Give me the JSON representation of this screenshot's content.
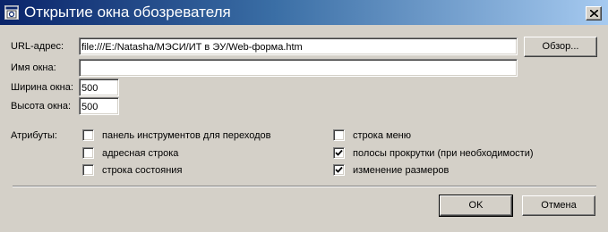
{
  "window": {
    "title": "Открытие окна обозревателя",
    "icon": "browser-window-icon",
    "close_icon": "close-icon"
  },
  "form": {
    "url": {
      "label": "URL-адрес:",
      "value": "file:///E:/Natasha/МЭСИ/ИТ в ЭУ/Web-форма.htm"
    },
    "browse_label": "Обзор...",
    "window_name": {
      "label": "Имя окна:",
      "value": ""
    },
    "width": {
      "label": "Ширина окна:",
      "value": "500"
    },
    "height": {
      "label": "Высота окна:",
      "value": "500"
    }
  },
  "attributes": {
    "label": "Атрибуты:",
    "items": [
      {
        "label": "панель инструментов для переходов",
        "checked": false
      },
      {
        "label": "адресная строка",
        "checked": false
      },
      {
        "label": "строка состояния",
        "checked": false
      },
      {
        "label": "строка меню",
        "checked": false
      },
      {
        "label": "полосы прокрутки (при необходимости)",
        "checked": true
      },
      {
        "label": "изменение размеров",
        "checked": true
      }
    ]
  },
  "buttons": {
    "ok": "OK",
    "cancel": "Отмена"
  },
  "colors": {
    "titlebar_start": "#0a246a",
    "titlebar_end": "#a6caf0",
    "face": "#d4d0c8"
  }
}
